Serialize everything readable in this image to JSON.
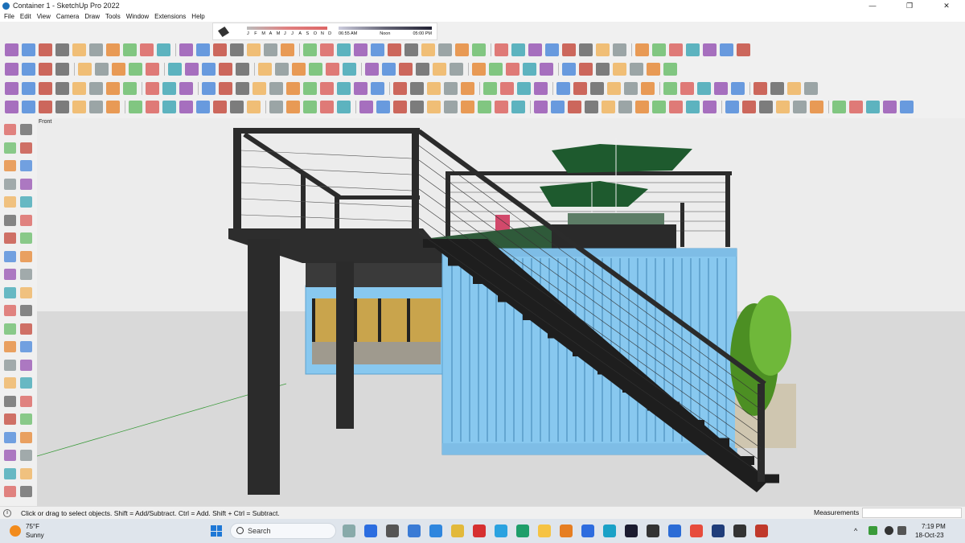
{
  "window": {
    "title": "Container 1 - SketchUp Pro 2022",
    "controls": [
      "—",
      "❐",
      "✕"
    ]
  },
  "menu": [
    "File",
    "Edit",
    "View",
    "Camera",
    "Draw",
    "Tools",
    "Window",
    "Extensions",
    "Help"
  ],
  "shadows": {
    "months": [
      "J",
      "F",
      "M",
      "A",
      "M",
      "J",
      "J",
      "A",
      "S",
      "O",
      "N",
      "D"
    ],
    "time_start": "06:55 AM",
    "time_mid": "Noon",
    "time_end": "05:00 PM"
  },
  "viewport": {
    "scene_label": "Front"
  },
  "status": {
    "message": "Click or drag to select objects. Shift = Add/Subtract. Ctrl = Add. Shift + Ctrl = Subtract.",
    "measurements_label": "Measurements",
    "measurements_value": ""
  },
  "taskbar": {
    "weather_temp": "75°F",
    "weather_desc": "Sunny",
    "search_label": "Search",
    "time": "7:19 PM",
    "date": "18-Oct-23"
  },
  "colors": {
    "container_blue": "#88c8ef",
    "steel_dark": "#2b2b2b",
    "ground": "#d9d9d9",
    "sky": "#ececec",
    "umbrella_green": "#1e5a2e"
  }
}
